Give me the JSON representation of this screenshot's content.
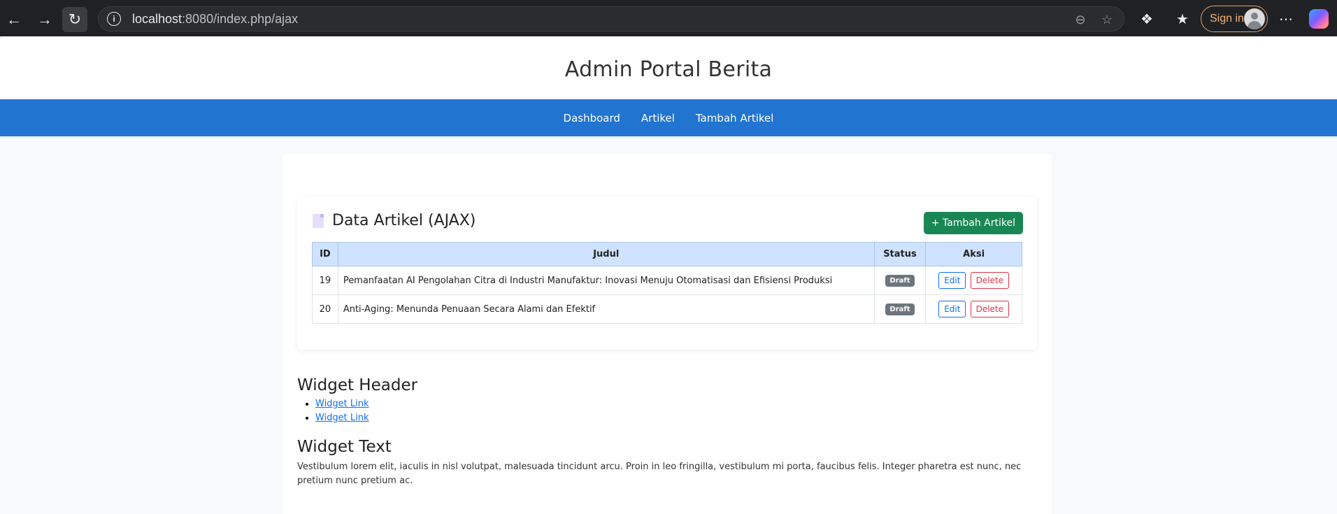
{
  "browser": {
    "url_host": "localhost",
    "url_rest": ":8080/index.php/ajax",
    "sign_in_label": "Sign in"
  },
  "site": {
    "title": "Admin Portal Berita",
    "nav": [
      {
        "label": "Dashboard"
      },
      {
        "label": "Artikel"
      },
      {
        "label": "Tambah Artikel"
      }
    ]
  },
  "card": {
    "title": "Data Artikel (AJAX)",
    "add_button": "+ Tambah Artikel",
    "columns": [
      "ID",
      "Judul",
      "Status",
      "Aksi"
    ],
    "rows": [
      {
        "id": "19",
        "judul": "Pemanfaatan AI Pengolahan Citra di Industri Manufaktur: Inovasi Menuju Otomatisasi dan Efisiensi Produksi",
        "status": "Draft",
        "edit": "Edit",
        "delete": "Delete"
      },
      {
        "id": "20",
        "judul": "Anti-Aging: Menunda Penuaan Secara Alami dan Efektif",
        "status": "Draft",
        "edit": "Edit",
        "delete": "Delete"
      }
    ]
  },
  "widget_header": {
    "title": "Widget Header",
    "links": [
      "Widget Link",
      "Widget Link"
    ]
  },
  "widget_text": {
    "title": "Widget Text",
    "body": "Vestibulum lorem elit, iaculis in nisl volutpat, malesuada tincidunt arcu. Proin in leo fringilla, vestibulum mi porta, faucibus felis. Integer pharetra est nunc, nec pretium nunc pretium ac."
  },
  "colors": {
    "nav_bar": "#2174d0",
    "add_button": "#198754",
    "table_header": "#cfe2ff",
    "badge_draft": "#6c757d"
  },
  "icons": [
    "back-arrow-icon",
    "forward-arrow-icon",
    "reload-icon",
    "site-info-icon",
    "zoom-out-icon",
    "favorite-star-icon",
    "extensions-icon",
    "favorites-icon",
    "profile-avatar-icon",
    "more-menu-icon",
    "copilot-icon",
    "document-icon"
  ]
}
